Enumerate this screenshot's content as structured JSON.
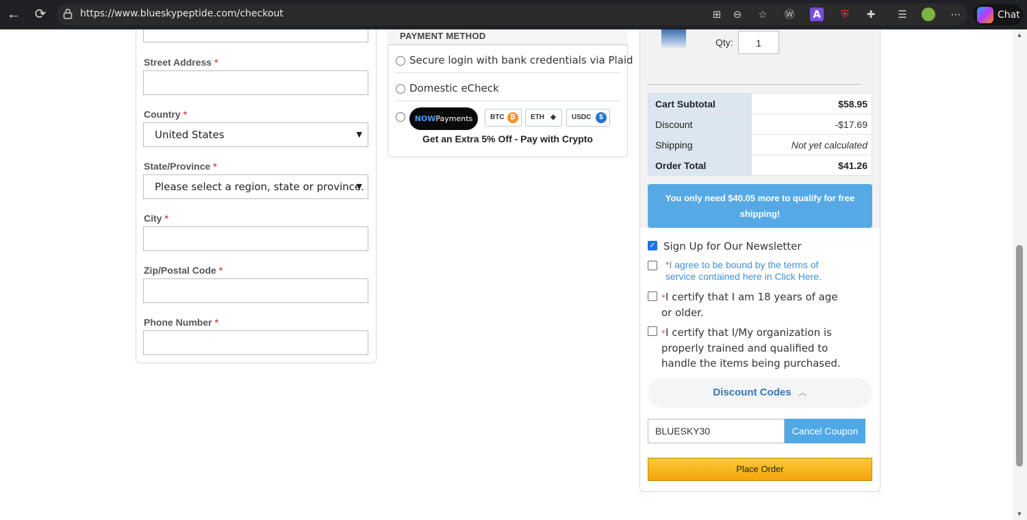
{
  "browser": {
    "url": "https://www.blueskypeptide.com/checkout",
    "chat_label": "Chat"
  },
  "address_form": {
    "fields": [
      {
        "label": "Street Address",
        "value": ""
      },
      {
        "label": "Country",
        "value": "United States"
      },
      {
        "label": "State/Province",
        "value": "Please select a region, state or province."
      },
      {
        "label": "City",
        "value": ""
      },
      {
        "label": "Zip/Postal Code",
        "value": ""
      },
      {
        "label": "Phone Number",
        "value": ""
      }
    ],
    "required_mark": "*"
  },
  "payment": {
    "header": "PAYMENT METHOD",
    "options": [
      "Secure login with bank credentials via Plaid",
      "Domestic eCheck"
    ],
    "nowpayments": {
      "brand_bold": "NOW",
      "brand_rest": "Payments"
    },
    "coins": [
      {
        "label": "BTC",
        "symbol": "₿",
        "color": "#f7931a"
      },
      {
        "label": "ETH",
        "symbol": "◆",
        "color": "#333333"
      },
      {
        "label": "USDC",
        "symbol": "$",
        "color": "#2775ca"
      }
    ],
    "crypto_offer": "Get an Extra 5% Off - Pay with Crypto"
  },
  "summary": {
    "qty_label": "Qty:",
    "qty_value": "1",
    "rows": [
      {
        "label": "Cart Subtotal",
        "value": "$58.95"
      },
      {
        "label": "Discount",
        "value": "-$17.69"
      },
      {
        "label": "Shipping",
        "value": "Not yet calculated"
      },
      {
        "label": "Order Total",
        "value": "$41.26"
      }
    ],
    "free_shipping_msg": "You only need $40.05 more to qualify for free shipping!",
    "newsletter": "Sign Up for Our Newsletter",
    "terms_mark": "*",
    "terms_text": "I agree to be bound by the terms of service contained here in Click Here.",
    "age_text": "I certify that I am 18 years of age or older.",
    "trained_text": "I certify that I/My organization is properly trained and qualified to handle the items being purchased.",
    "discount_codes_label": "Discount Codes",
    "coupon_value": "BLUESKY30",
    "cancel_coupon": "Cancel Coupon",
    "place_order": "Place Order"
  },
  "colors": {
    "accent_blue": "#57a9e6",
    "place_order": "#f4a40c",
    "required": "#d9534f"
  }
}
